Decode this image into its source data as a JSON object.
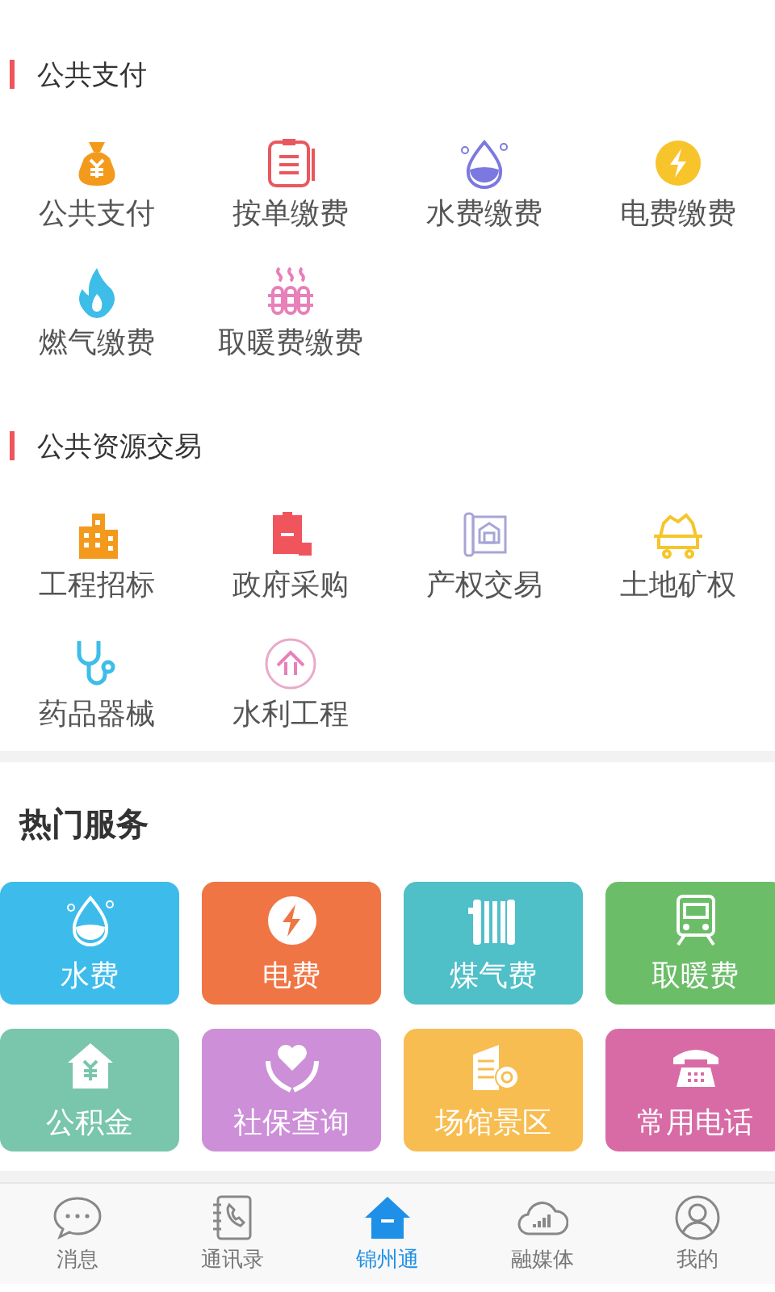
{
  "sections": [
    {
      "title": "公共支付",
      "items": [
        {
          "label": "公共支付"
        },
        {
          "label": "按单缴费"
        },
        {
          "label": "水费缴费"
        },
        {
          "label": "电费缴费"
        },
        {
          "label": "燃气缴费"
        },
        {
          "label": "取暖费缴费"
        }
      ]
    },
    {
      "title": "公共资源交易",
      "items": [
        {
          "label": "工程招标"
        },
        {
          "label": "政府采购"
        },
        {
          "label": "产权交易"
        },
        {
          "label": "土地矿权"
        },
        {
          "label": "药品器械"
        },
        {
          "label": "水利工程"
        }
      ]
    }
  ],
  "hot": {
    "title": "热门服务",
    "tiles": [
      {
        "label": "水费",
        "color": "#3dbcec"
      },
      {
        "label": "电费",
        "color": "#f07544"
      },
      {
        "label": "煤气费",
        "color": "#4fbfc8"
      },
      {
        "label": "取暖费",
        "color": "#6bbd68"
      },
      {
        "label": "公积金",
        "color": "#79c6ad"
      },
      {
        "label": "社保查询",
        "color": "#cd8fd8"
      },
      {
        "label": "场馆景区",
        "color": "#f8bd50"
      },
      {
        "label": "常用电话",
        "color": "#d86ba5"
      }
    ]
  },
  "tabs": [
    {
      "label": "消息",
      "selected": false
    },
    {
      "label": "通讯录",
      "selected": false
    },
    {
      "label": "锦州通",
      "selected": true
    },
    {
      "label": "融媒体",
      "selected": false
    },
    {
      "label": "我的",
      "selected": false
    }
  ]
}
